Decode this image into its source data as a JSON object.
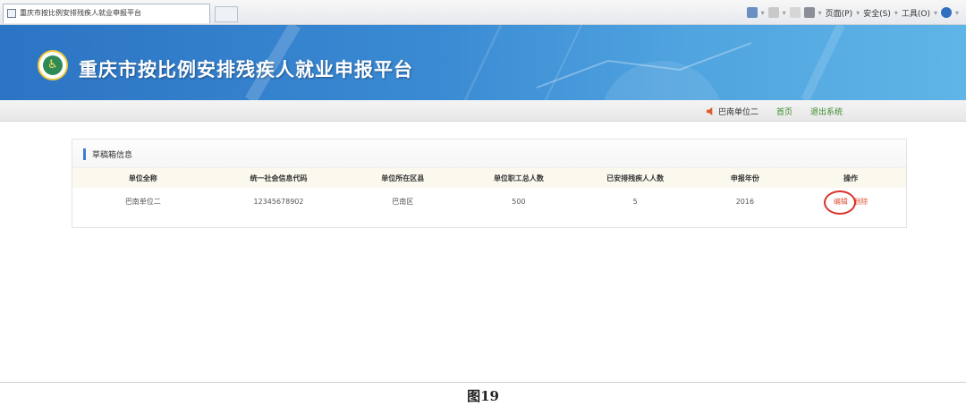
{
  "browser": {
    "tab_title": "重庆市按比例安排残疾人就业申报平台",
    "commands": {
      "page": "页面(P)",
      "safety": "安全(S)",
      "tools": "工具(O)"
    }
  },
  "header": {
    "site_title": "重庆市按比例安排残疾人就业申报平台"
  },
  "nav": {
    "user": "巴南单位二",
    "home": "首页",
    "logout": "退出系统"
  },
  "panel": {
    "title": "草稿箱信息",
    "columns": [
      "单位全称",
      "统一社会信息代码",
      "单位所在区县",
      "单位职工总人数",
      "已安排残疾人人数",
      "申报年份",
      "操作"
    ],
    "row": {
      "name": "巴南单位二",
      "code": "12345678902",
      "district": "巴南区",
      "staff_total": "500",
      "disabled_count": "5",
      "year": "2016",
      "edit_label": "编辑",
      "delete_label": "删除"
    }
  },
  "caption": "图19",
  "colors": {
    "banner": "#3a8ad3",
    "accent": "#3b7ed2",
    "highlight_circle": "#d9322a",
    "action_text": "#e0563a",
    "nav_link": "#3a8b2a"
  }
}
